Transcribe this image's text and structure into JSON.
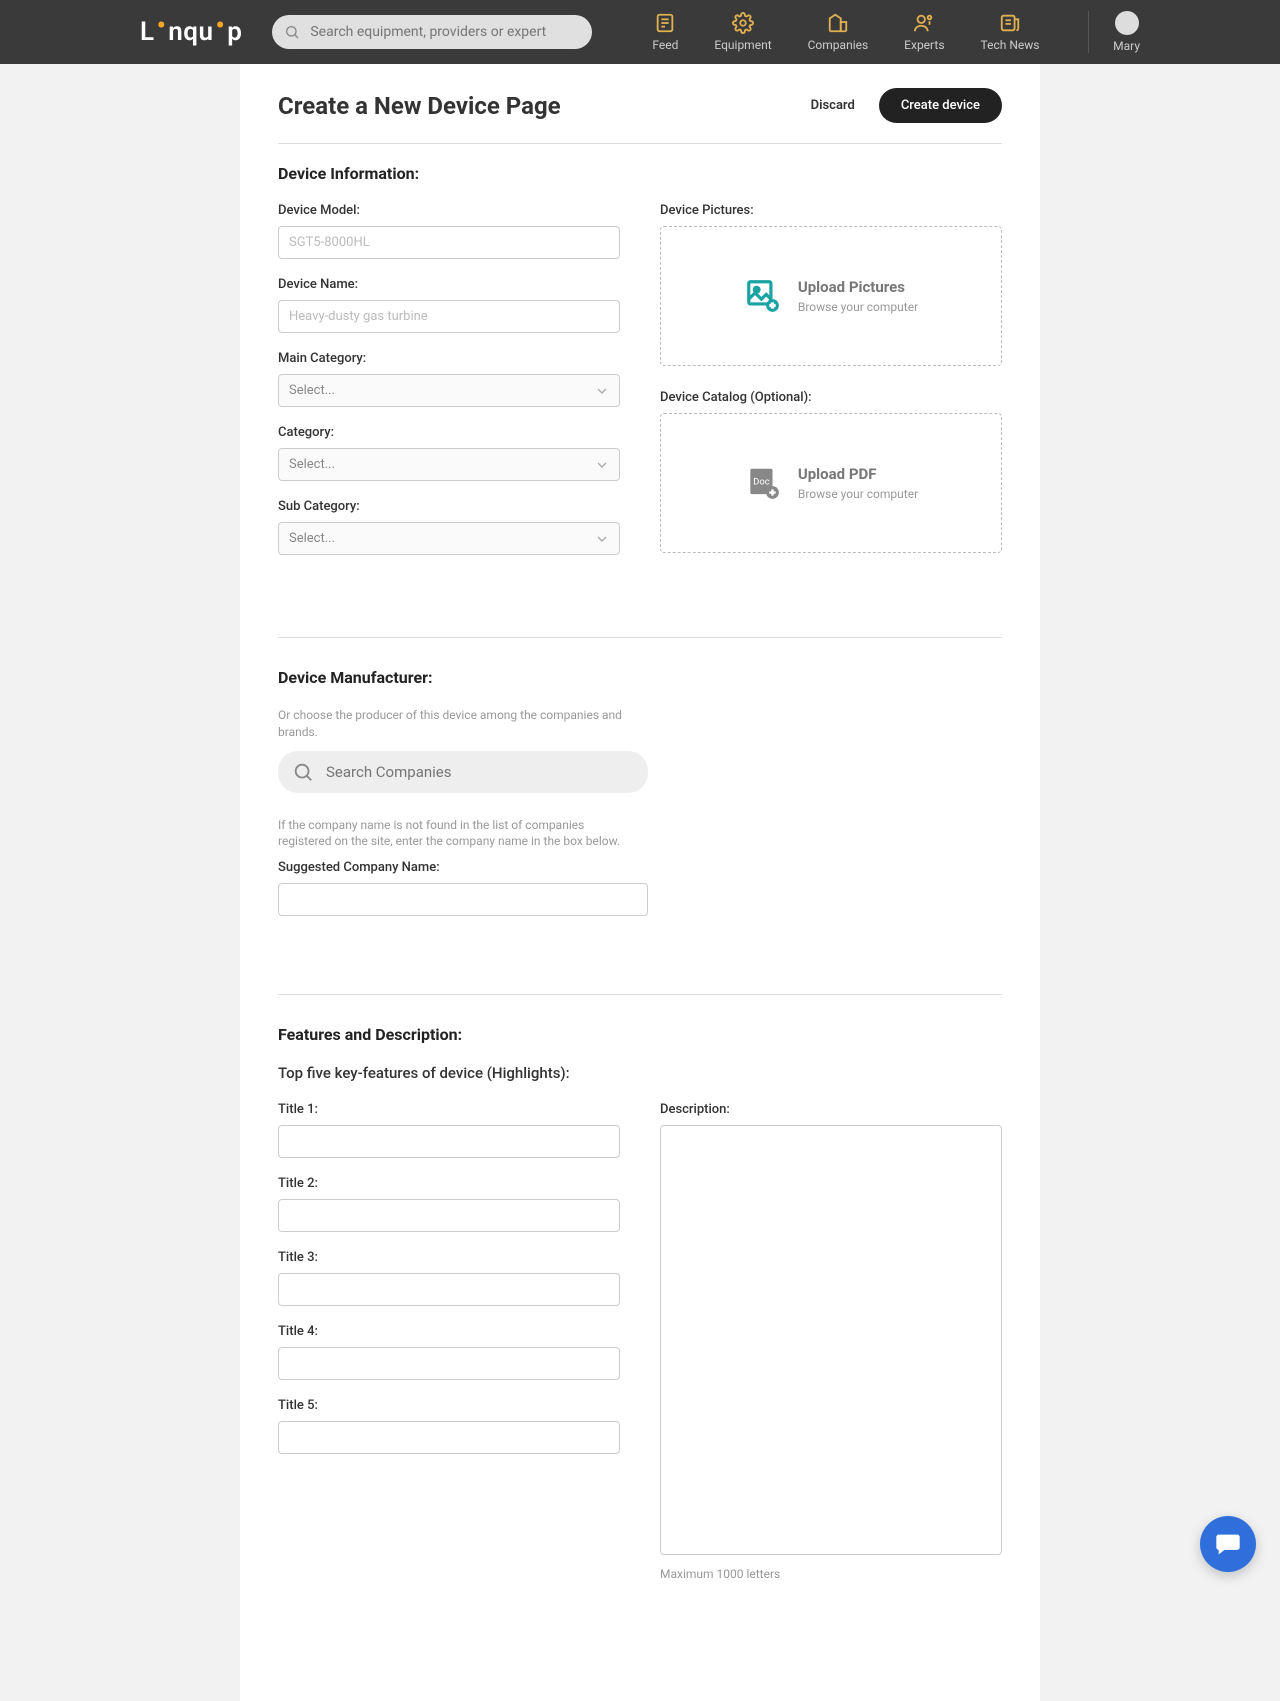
{
  "header": {
    "brand": "Linquip",
    "search_placeholder": "Search equipment, providers or expert",
    "nav": [
      {
        "label": "Feed"
      },
      {
        "label": "Equipment"
      },
      {
        "label": "Companies"
      },
      {
        "label": "Experts"
      },
      {
        "label": "Tech News"
      }
    ],
    "user_name": "Mary"
  },
  "page": {
    "title": "Create a New Device Page",
    "discard": "Discard",
    "create": "Create device"
  },
  "info": {
    "section_title": "Device Information:",
    "model": {
      "label": "Device Model:",
      "placeholder": "SGT5-8000HL",
      "value": ""
    },
    "name": {
      "label": "Device Name:",
      "placeholder": "Heavy-dusty gas turbine",
      "value": ""
    },
    "main_cat": {
      "label": "Main Category:",
      "placeholder": "Select..."
    },
    "cat": {
      "label": "Category:",
      "placeholder": "Select..."
    },
    "sub_cat": {
      "label": "Sub Category:",
      "placeholder": "Select..."
    },
    "pictures_label": "Device Pictures:",
    "upload_pictures": {
      "title": "Upload Pictures",
      "subtitle": "Browse your computer"
    },
    "catalog_label": "Device Catalog (Optional):",
    "upload_pdf": {
      "title": "Upload PDF",
      "subtitle": "Browse your computer"
    }
  },
  "manufacturer": {
    "section_title": "Device Manufacturer:",
    "help_top": "Or choose the producer of this device among the companies and brands.",
    "search_placeholder": "Search Companies",
    "help_bottom": "If the company name is not found in the list of companies registered on the site, enter the company name in the box below.",
    "suggested_label": "Suggested Company Name:",
    "suggested_value": ""
  },
  "features": {
    "section_title": "Features and Description:",
    "sub_title": "Top five key-features of device (Highlights):",
    "titles": [
      {
        "label": "Title 1:",
        "value": ""
      },
      {
        "label": "Title 2:",
        "value": ""
      },
      {
        "label": "Title 3:",
        "value": ""
      },
      {
        "label": "Title 4:",
        "value": ""
      },
      {
        "label": "Title 5:",
        "value": ""
      }
    ],
    "description_label": "Description:",
    "description_value": "",
    "max_note": "Maximum 1000 letters"
  }
}
